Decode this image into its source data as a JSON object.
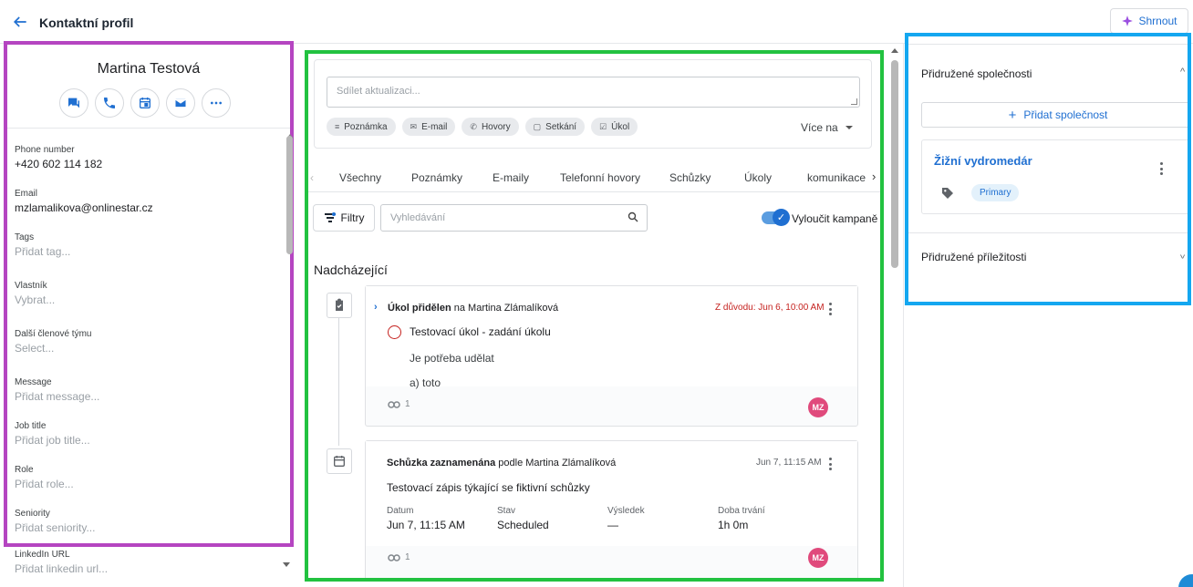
{
  "header": {
    "title": "Kontaktní profil",
    "summarize_label": "Shrnout"
  },
  "contact": {
    "name": "Martina Testová",
    "actions": [
      "chat-icon",
      "phone-icon",
      "calendar-icon",
      "email-icon",
      "more-icon"
    ]
  },
  "fields": [
    {
      "label": "Phone number",
      "value": "+420 602 114 182",
      "placeholder": false
    },
    {
      "label": "Email",
      "value": "mzlamalikova@onlinestar.cz",
      "placeholder": false
    },
    {
      "label": "Tags",
      "value": "Přidat tag...",
      "placeholder": true
    },
    {
      "label": "Vlastník",
      "value": "Vybrat...",
      "placeholder": true
    },
    {
      "label": "Další členové týmu",
      "value": "Select...",
      "placeholder": true
    },
    {
      "label": "Message",
      "value": "Přidat message...",
      "placeholder": true
    },
    {
      "label": "Job title",
      "value": "Přidat job title...",
      "placeholder": true
    },
    {
      "label": "Role",
      "value": "Přidat role...",
      "placeholder": true
    },
    {
      "label": "Seniority",
      "value": "Přidat seniority...",
      "placeholder": true
    },
    {
      "label": "LinkedIn URL",
      "value": "Přidat linkedin url...",
      "placeholder": true
    }
  ],
  "composer": {
    "placeholder": "Sdílet aktualizaci...",
    "chips": [
      "Poznámka",
      "E-mail",
      "Hovory",
      "Setkání",
      "Úkol"
    ],
    "more_label": "Více na"
  },
  "tabs": [
    "Všechny",
    "Poznámky",
    "E-maily",
    "Telefonní hovory",
    "Schůzky",
    "Úkoly",
    "komunikace"
  ],
  "filters": {
    "filter_label": "Filtry",
    "search_placeholder": "Vyhledávání",
    "toggle_label": "Vyloučit kampaně",
    "toggle_on": true
  },
  "upcoming": {
    "title": "Nadcházející",
    "task_card": {
      "action": "Úkol přidělen",
      "connector": " na ",
      "person": "Martina Zlámalíková",
      "due": "Z důvodu: Jun 6, 10:00 AM",
      "task_title": "Testovací úkol - zadání úkolu",
      "lines": [
        "Je potřeba udělat",
        "a) toto"
      ],
      "link_count": "1",
      "avatar": "MZ"
    },
    "meeting_card": {
      "action": "Schůzka zaznamenána",
      "connector": " podle ",
      "person": "Martina Zlámalíková",
      "date": "Jun 7, 11:15 AM",
      "description": "Testovací zápis týkající se fiktivní schůzky",
      "meta": [
        {
          "label": "Datum",
          "value": "Jun 7, 11:15 AM"
        },
        {
          "label": "Stav",
          "value": "Scheduled"
        },
        {
          "label": "Výsledek",
          "value": "—"
        },
        {
          "label": "Doba trvání",
          "value": "1h 0m"
        }
      ],
      "link_count": "1",
      "avatar": "MZ"
    }
  },
  "right": {
    "companies_title": "Přidružené společnosti",
    "add_company_label": "Přidat společnost",
    "company_name": "Žižní vydromedár",
    "company_badge": "Primary",
    "opportunities_title": "Přidružené příležitosti"
  },
  "colors": {
    "accent": "#1f6fd1",
    "left_highlight": "#b545c1",
    "center_highlight": "#22c240",
    "right_highlight": "#14a7f0",
    "due_red": "#c5221f",
    "avatar_pink": "#e04a7c"
  }
}
